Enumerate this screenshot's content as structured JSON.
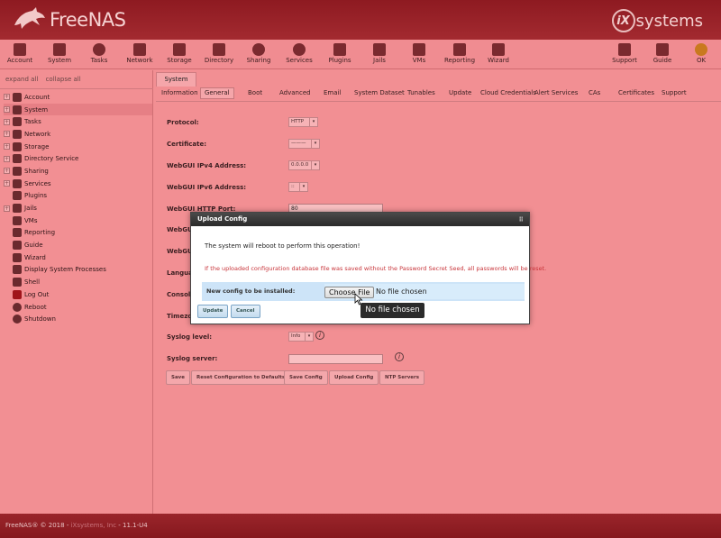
{
  "header": {
    "brand": "FreeNAS",
    "vendor_mark": "iX",
    "vendor_word": "systems"
  },
  "toolbar": {
    "items": [
      "Account",
      "System",
      "Tasks",
      "Network",
      "Storage",
      "Directory",
      "Sharing",
      "Services",
      "Plugins",
      "Jails",
      "VMs",
      "Reporting",
      "Wizard"
    ],
    "right_items": [
      "Support",
      "Guide",
      "OK"
    ]
  },
  "sidebar": {
    "expand_all": "expand all",
    "collapse_all": "collapse all",
    "items": [
      "Account",
      "System",
      "Tasks",
      "Network",
      "Storage",
      "Directory Service",
      "Sharing",
      "Services",
      "Plugins",
      "Jails",
      "VMs",
      "Reporting",
      "Guide",
      "Wizard",
      "Display System Processes",
      "Shell",
      "Log Out",
      "Reboot",
      "Shutdown"
    ],
    "selected": "System"
  },
  "main": {
    "tab": "System",
    "subtabs": [
      "Information",
      "General",
      "Boot",
      "Advanced",
      "Email",
      "System Dataset",
      "Tunables",
      "Update",
      "Cloud Credentials",
      "Alert Services",
      "CAs",
      "Certificates",
      "Support"
    ],
    "active_subtab": "General",
    "form": {
      "protocol_label": "Protocol:",
      "protocol_value": "HTTP",
      "certificate_label": "Certificate:",
      "certificate_value": "———",
      "ipv4_label": "WebGUI IPv4 Address:",
      "ipv4_value": "0.0.0.0",
      "ipv6_label": "WebGUI IPv6 Address:",
      "ipv6_value": "::",
      "http_port_label": "WebGUI HTTP Port:",
      "http_port_value": "80",
      "webgui_a_label": "WebGU",
      "webgui_b_label": "WebGU",
      "language_label": "Langua",
      "console_label": "Console",
      "timezone_label": "Timezo",
      "syslog_level_label": "Syslog level:",
      "syslog_level_value": "Info",
      "syslog_server_label": "Syslog server:",
      "syslog_server_value": ""
    },
    "buttons": [
      "Save",
      "Reset Configuration to Defaults",
      "Save Config",
      "Upload Config",
      "NTP Servers"
    ]
  },
  "dialog": {
    "title": "Upload Config",
    "message": "The system will reboot to perform this operation!",
    "warning": "If the uploaded configuration database file was saved without the Password Secret Seed, all passwords will be reset.",
    "field_label": "New config to be installed:",
    "choose_label": "Choose File",
    "no_file": "No file chosen",
    "update_label": "Update",
    "cancel_label": "Cancel"
  },
  "tooltip": "No file chosen",
  "footer": {
    "copyright": "FreeNAS® © 2018 - ",
    "link": "iXsystems, Inc",
    "version": " - 11.1-U4"
  }
}
